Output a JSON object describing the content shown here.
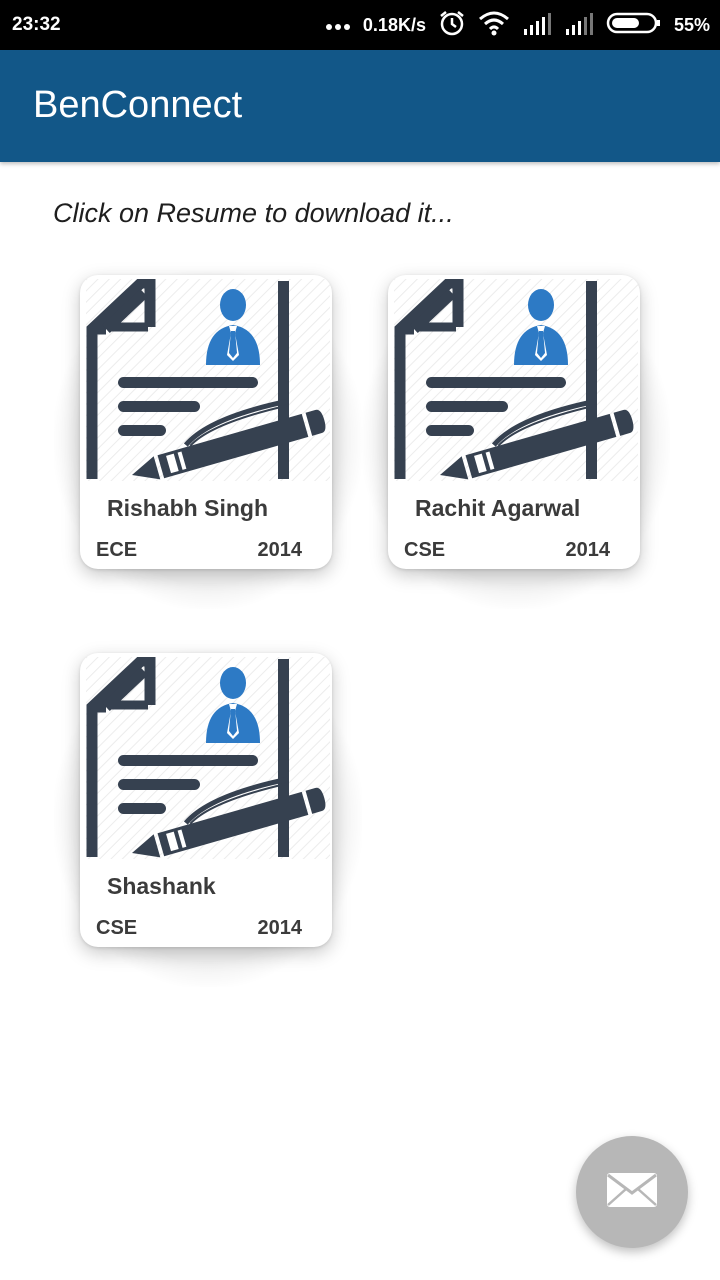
{
  "status_bar": {
    "time": "23:32",
    "network_speed": "0.18K/s",
    "battery": "55%",
    "icons": [
      "more-dots-icon",
      "alarm-icon",
      "wifi-icon",
      "signal-icon",
      "signal-icon",
      "battery-icon"
    ]
  },
  "app_bar": {
    "title": "BenConnect"
  },
  "instruction": "Click on Resume to download it...",
  "resumes": [
    {
      "name": "Rishabh Singh",
      "branch": "ECE",
      "year": "2014",
      "icon": "resume-icon"
    },
    {
      "name": "Rachit Agarwal",
      "branch": "CSE",
      "year": "2014",
      "icon": "resume-icon"
    },
    {
      "name": "Shashank",
      "branch": "CSE",
      "year": "2014",
      "icon": "resume-icon"
    }
  ],
  "fab": {
    "icon": "mail-icon"
  },
  "colors": {
    "app_bar": "#125788",
    "resume_dark": "#364150",
    "resume_person": "#2d7ac5",
    "fab": "#b7b7b7"
  }
}
